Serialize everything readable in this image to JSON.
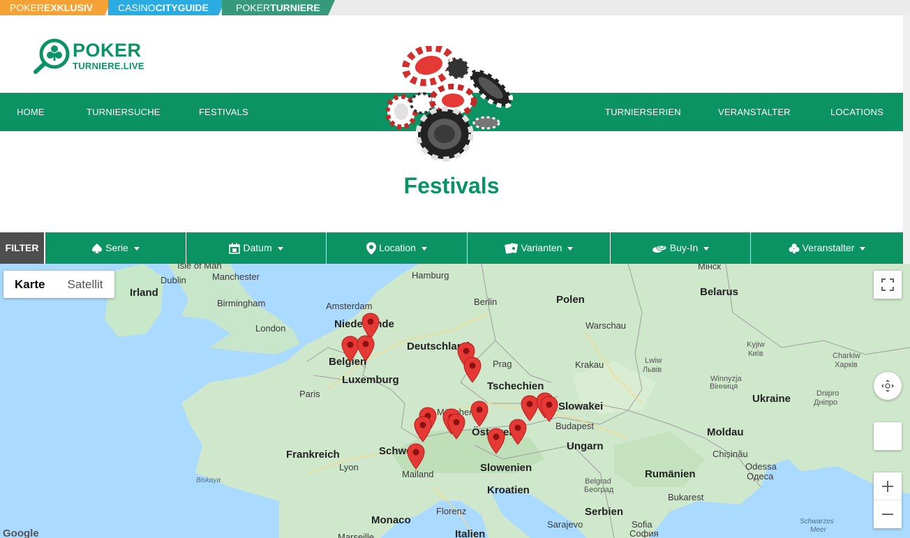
{
  "site_tabs": [
    {
      "light": "POKER",
      "bold": "EXKLUSIV",
      "color": "#f4a236"
    },
    {
      "light": "CASINO",
      "bold": "CITYGUIDE",
      "color": "#2aace2"
    },
    {
      "light": "POKER",
      "bold": "TURNIERE",
      "color": "#35997a"
    }
  ],
  "logo": {
    "word1": "POKER",
    "word2": "TURNIERE.LIVE",
    "icon": "magnifier-clubs-logo-icon"
  },
  "nav": {
    "items": [
      "HOME",
      "TURNIERSUCHE",
      "FESTIVALS",
      "TURNIERSERIEN",
      "VERANSTALTER",
      "LOCATIONS"
    ]
  },
  "page": {
    "title": "Festivals"
  },
  "filter": {
    "label": "FILTER",
    "buttons": [
      {
        "label": "Serie",
        "icon": "spade-icon"
      },
      {
        "label": "Datum",
        "icon": "calendar-icon"
      },
      {
        "label": "Location",
        "icon": "map-marker-icon"
      },
      {
        "label": "Varianten",
        "icon": "cards-icon"
      },
      {
        "label": "Buy-In",
        "icon": "coins-icon"
      },
      {
        "label": "Veranstalter",
        "icon": "club-icon"
      }
    ]
  },
  "map": {
    "type_options": [
      "Karte",
      "Satellit"
    ],
    "active_type": "Karte",
    "attribution": "Google",
    "labels": {
      "isle_of_man": "Isle of Man",
      "manchester": "Manchester",
      "dublin": "Dublin",
      "irland": "Irland",
      "birmingham": "Birmingham",
      "london": "London",
      "hamburg": "Hamburg",
      "amsterdam": "Amsterdam",
      "niederlande": "Niederlande",
      "berlin": "Berlin",
      "polen": "Polen",
      "warschau": "Warschau",
      "minsk": "Мінск",
      "belarus": "Belarus",
      "deutschland": "Deutschland",
      "belgien": "Belgien",
      "luxemburg": "Luxemburg",
      "prag": "Prag",
      "krakau": "Krakau",
      "lwiw": "Lwiw",
      "lwiw_local": "Львів",
      "kyjiw": "Kyjiw",
      "kyjiw_local": "Київ",
      "charkiw": "Charkiw",
      "charkiw_local": "Харків",
      "paris": "Paris",
      "tschechien": "Tschechien",
      "winnyzja": "Winnyzja",
      "winnyzja_local": "Вінниця",
      "ukraine": "Ukraine",
      "dnipro": "Dnipro",
      "dnipro_local": "Дніпро",
      "muenchen": "München",
      "slowakei": "Slowakei",
      "budapest": "Budapest",
      "oesterreich": "Österreich",
      "moldau": "Moldau",
      "frankreich": "Frankreich",
      "schweiz": "Schweiz",
      "ungarn": "Ungarn",
      "chisinau": "Chișinău",
      "lyon": "Lyon",
      "slowenien": "Slowenien",
      "odessa": "Odessa",
      "odessa_local": "Одеса",
      "mailand": "Mailand",
      "biskaya": "Biskaya",
      "rumaenien": "Rumänien",
      "belgrad": "Belgrad",
      "belgrad_local": "Београд",
      "kroatien": "Kroatien",
      "bukarest": "Bukarest",
      "monaco": "Monaco",
      "florenz": "Florenz",
      "serbien": "Serbien",
      "sarajevo": "Sarajevo",
      "sofia": "Sofia",
      "sofia_local": "София",
      "schwarzes_meer": "Schwarzes",
      "schwarzes_meer2": "Meer",
      "marseille": "Marseille",
      "italien": "Italien"
    },
    "pin_color": "#e53935"
  },
  "colors": {
    "brand_green": "#0b9363",
    "filter_dark": "#4e4e4e"
  }
}
